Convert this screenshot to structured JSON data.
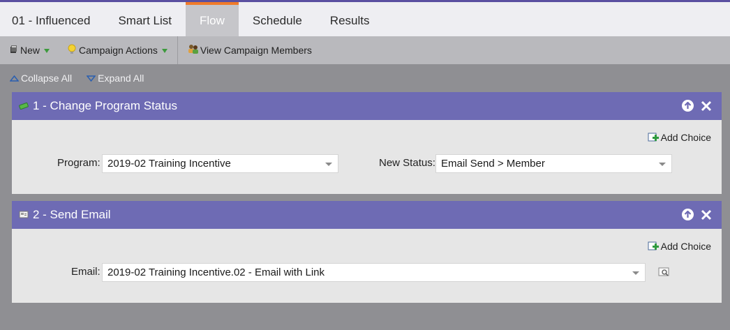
{
  "tabs": [
    {
      "label": "01 - Influenced"
    },
    {
      "label": "Smart List"
    },
    {
      "label": "Flow",
      "active": true
    },
    {
      "label": "Schedule"
    },
    {
      "label": "Results"
    }
  ],
  "toolbar": {
    "new_label": "New",
    "campaign_actions_label": "Campaign Actions",
    "view_members_label": "View Campaign Members"
  },
  "controls": {
    "collapse_label": "Collapse All",
    "expand_label": "Expand All"
  },
  "steps": [
    {
      "title": "1 - Change Program Status",
      "add_choice_label": "Add Choice",
      "fields": {
        "program_label": "Program:",
        "program_value": "2019-02 Training Incentive",
        "status_label": "New Status:",
        "status_value": "Email Send > Member"
      }
    },
    {
      "title": "2 - Send Email",
      "add_choice_label": "Add Choice",
      "fields": {
        "email_label": "Email:",
        "email_value": "2019-02 Training Incentive.02 - Email with Link"
      }
    }
  ],
  "colors": {
    "accent_tab": "#f07b2a",
    "step_header": "#6e6bb4",
    "background": "#8f8f93"
  }
}
